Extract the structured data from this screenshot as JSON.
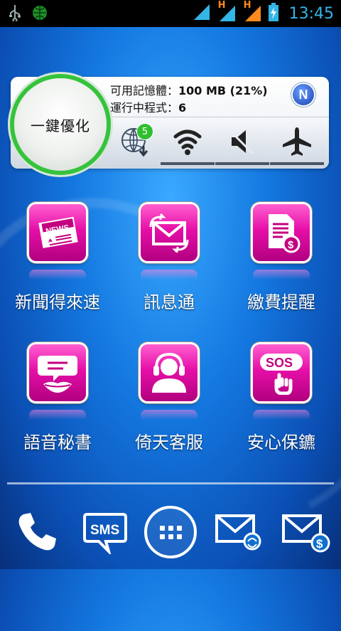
{
  "status_bar": {
    "left_icons": [
      "usb-icon",
      "globe-icon"
    ],
    "network_labels": [
      "H",
      "H"
    ],
    "time": "13:45"
  },
  "widget": {
    "boost_label": "一鍵優化",
    "memory_label": "可用記憶體：",
    "memory_value": "100 MB (21%)",
    "running_label": "運行中程式：",
    "running_value": "6",
    "logo_letter": "N",
    "update_badge": "5",
    "toggles": [
      "wifi-icon",
      "mute-icon",
      "airplane-icon"
    ]
  },
  "apps": [
    {
      "label": "新聞得來速",
      "icon": "news-icon"
    },
    {
      "label": "訊息通",
      "icon": "envelope-refresh-icon"
    },
    {
      "label": "繳費提醒",
      "icon": "bill-icon"
    },
    {
      "label": "語音秘書",
      "icon": "voice-icon"
    },
    {
      "label": "倚天客服",
      "icon": "headset-icon"
    },
    {
      "label": "安心保鑣",
      "icon": "sos-icon"
    }
  ],
  "sos_text": "SOS",
  "news_text": "NEWS",
  "dock": {
    "sms_text": "SMS",
    "items": [
      "phone-icon",
      "sms-icon",
      "app-drawer-icon",
      "email-icon",
      "email-dollar-icon"
    ]
  },
  "colors": {
    "accent": "#33b5e5",
    "app_icon": "#e60fa8",
    "boost_ring": "#35c33c"
  }
}
